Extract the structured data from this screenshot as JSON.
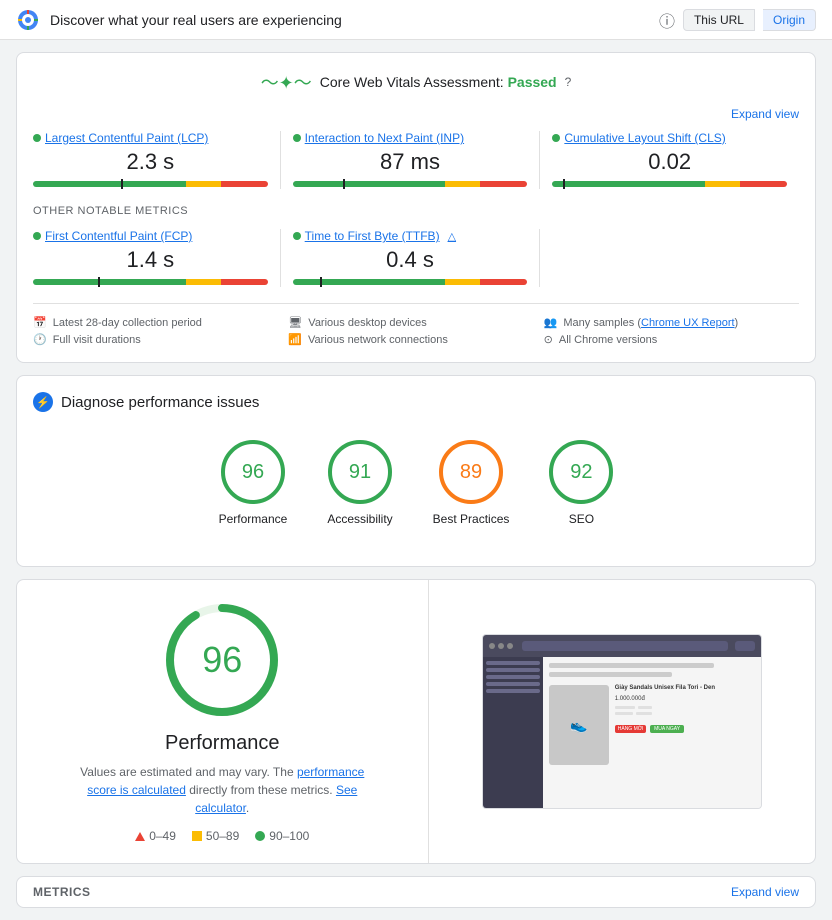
{
  "header": {
    "title": "Discover what your real users are experiencing",
    "url_label": "This URL",
    "origin_label": "Origin"
  },
  "cwv": {
    "title": "Core Web Vitals Assessment:",
    "status": "Passed",
    "expand_label": "Expand view",
    "metrics": [
      {
        "label": "Largest Contentful Paint (LCP)",
        "value": "2.3 s",
        "bar_green": 65,
        "bar_yellow": 15,
        "bar_red": 20,
        "indicator": 38
      },
      {
        "label": "Interaction to Next Paint (INP)",
        "value": "87 ms",
        "bar_green": 65,
        "bar_yellow": 15,
        "bar_red": 20,
        "indicator": 22
      },
      {
        "label": "Cumulative Layout Shift (CLS)",
        "value": "0.02",
        "bar_green": 65,
        "bar_yellow": 15,
        "bar_red": 20,
        "indicator": 5
      }
    ]
  },
  "other_metrics": {
    "title": "OTHER NOTABLE METRICS",
    "items": [
      {
        "label": "First Contentful Paint (FCP)",
        "value": "1.4 s",
        "bar_green": 65,
        "bar_yellow": 15,
        "bar_red": 20,
        "indicator": 28
      },
      {
        "label": "Time to First Byte (TTFB)",
        "value": "0.4 s",
        "bar_green": 65,
        "bar_yellow": 15,
        "bar_red": 20,
        "indicator": 12
      }
    ]
  },
  "footer_info": {
    "col1": [
      {
        "icon": "calendar",
        "text": "Latest 28-day collection period"
      },
      {
        "icon": "clock",
        "text": "Full visit durations"
      }
    ],
    "col2": [
      {
        "icon": "desktop",
        "text": "Various desktop devices"
      },
      {
        "icon": "wifi",
        "text": "Various network connections"
      }
    ],
    "col3": [
      {
        "icon": "users",
        "text": "Many samples"
      },
      {
        "icon": "chrome",
        "text": "All Chrome versions"
      },
      {
        "link_text": "Chrome UX Report",
        "link_before": "Many samples (",
        "link_after": ")"
      }
    ]
  },
  "diagnose": {
    "title": "Diagnose performance issues",
    "scores": [
      {
        "value": "96",
        "label": "Performance",
        "color": "green"
      },
      {
        "value": "91",
        "label": "Accessibility",
        "color": "green"
      },
      {
        "value": "89",
        "label": "Best Practices",
        "color": "orange"
      },
      {
        "value": "92",
        "label": "SEO",
        "color": "green"
      }
    ]
  },
  "performance_section": {
    "score": "96",
    "label": "Performance",
    "description_before": "Values are estimated and may vary. The ",
    "description_link1": "performance score is calculated",
    "description_middle": " directly from these metrics. ",
    "description_link2": "See calculator",
    "description_end": ".",
    "legend": [
      {
        "range": "0–49",
        "color": "red"
      },
      {
        "range": "50–89",
        "color": "yellow"
      },
      {
        "range": "90–100",
        "color": "green"
      }
    ]
  },
  "metrics_footer": {
    "label": "METRICS",
    "expand_label": "Expand view"
  }
}
